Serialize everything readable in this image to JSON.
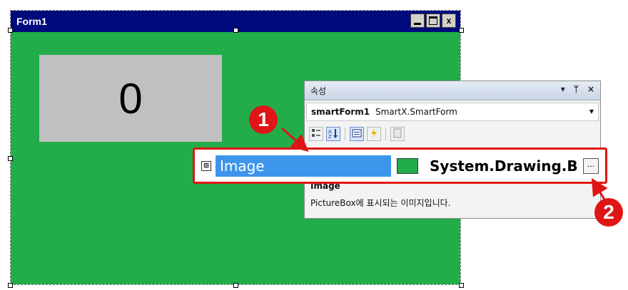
{
  "window": {
    "title": "Form1",
    "controls": {
      "minimize": "_",
      "maximize": "□",
      "close": "x"
    }
  },
  "form_content": {
    "counter_value": "0",
    "background_color": "#22ad4a"
  },
  "properties_panel": {
    "title": "속성",
    "header_icons": [
      "▾",
      "ᛘ",
      "×"
    ],
    "object_name": "smartForm1",
    "object_type": "SmartX.SmartForm",
    "toolbar_icons": [
      "categorized-icon",
      "alphabetical-icon",
      "properties-icon",
      "events-icon",
      "property-pages-icon"
    ],
    "selected_property": {
      "expand_symbol": "⊞",
      "name": "Image",
      "value": "System.Drawing.Bitr",
      "ellipsis": "..."
    },
    "description": {
      "title": "Image",
      "text": "PictureBox에 표시되는 이미지입니다."
    }
  },
  "callouts": [
    {
      "number": "1"
    },
    {
      "number": "2"
    }
  ],
  "colors": {
    "titlebar": "#000a7c",
    "form_green": "#22ad4a",
    "selection_blue": "#3d95ec",
    "callout_red": "#e01515"
  }
}
